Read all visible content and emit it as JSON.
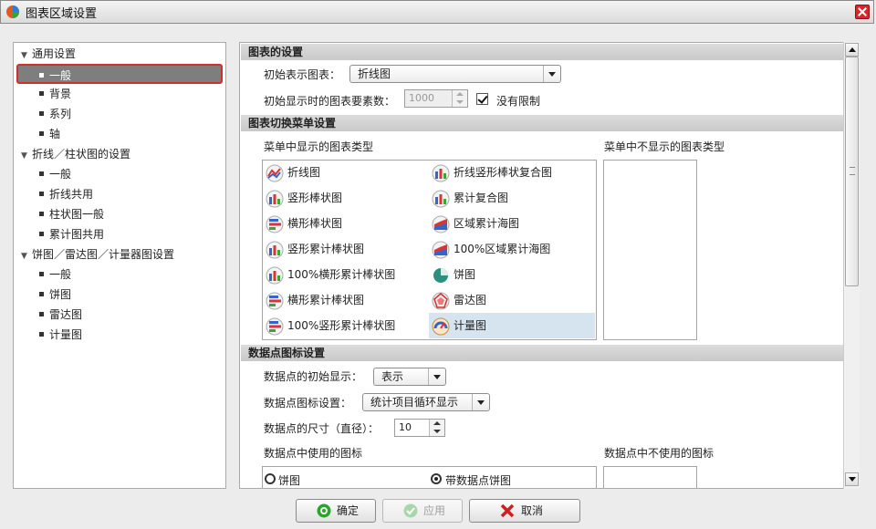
{
  "window": {
    "title": "图表区域设置"
  },
  "tree": {
    "items": [
      {
        "label": "通用设置",
        "type": "group"
      },
      {
        "label": "一般",
        "type": "child",
        "selected": true
      },
      {
        "label": "背景",
        "type": "child"
      },
      {
        "label": "系列",
        "type": "child"
      },
      {
        "label": "轴",
        "type": "child"
      },
      {
        "label": "折线／柱状图的设置",
        "type": "group"
      },
      {
        "label": "一般",
        "type": "child"
      },
      {
        "label": "折线共用",
        "type": "child"
      },
      {
        "label": "柱状图一般",
        "type": "child"
      },
      {
        "label": "累计图共用",
        "type": "child"
      },
      {
        "label": "饼图／雷达图／计量器图设置",
        "type": "group"
      },
      {
        "label": "一般",
        "type": "child"
      },
      {
        "label": "饼图",
        "type": "child"
      },
      {
        "label": "雷达图",
        "type": "child"
      },
      {
        "label": "计量图",
        "type": "child"
      }
    ]
  },
  "chart_settings": {
    "title": "图表的设置",
    "initial_chart_label": "初始表示图表：",
    "initial_chart_value": "折线图",
    "element_count_label": "初始显示时的图表要素数：",
    "element_count_value": "1000",
    "no_limit_label": "没有限制",
    "no_limit_checked": true
  },
  "switch_menu": {
    "title": "图表切换菜单设置",
    "shown_label": "菜单中显示的图表类型",
    "hidden_label": "菜单中不显示的图表类型",
    "left_column": [
      "折线图",
      "竖形棒状图",
      "横形棒状图",
      "竖形累计棒状图",
      "100%横形累计棒状图",
      "横形累计棒状图",
      "100%竖形累计棒状图"
    ],
    "right_column": [
      "折线竖形棒状复合图",
      "累计复合图",
      "区域累计海图",
      "100%区域累计海图",
      "饼图",
      "雷达图",
      "计量图"
    ],
    "selected_item": "计量图"
  },
  "data_points": {
    "title": "数据点图标设置",
    "initial_display_label": "数据点的初始显示：",
    "initial_display_value": "表示",
    "icon_setting_label": "数据点图标设置：",
    "icon_setting_value": "统计项目循环显示",
    "size_label": "数据点的尺寸（直径）：",
    "size_value": "10",
    "used_icons_label": "数据点中使用的图标",
    "unused_icons_label": "数据点中不使用的图标",
    "icons": [
      {
        "label": "饼图",
        "selected": false
      },
      {
        "label": "带数据点饼图",
        "selected": true
      }
    ]
  },
  "buttons": {
    "ok": "确定",
    "apply": "应用",
    "cancel": "取消"
  },
  "colors": {
    "selection_border": "#d12e2e",
    "close_red": "#d8262b",
    "ok_green": "#2aa52a",
    "cancel_red": "#d11f1f"
  }
}
